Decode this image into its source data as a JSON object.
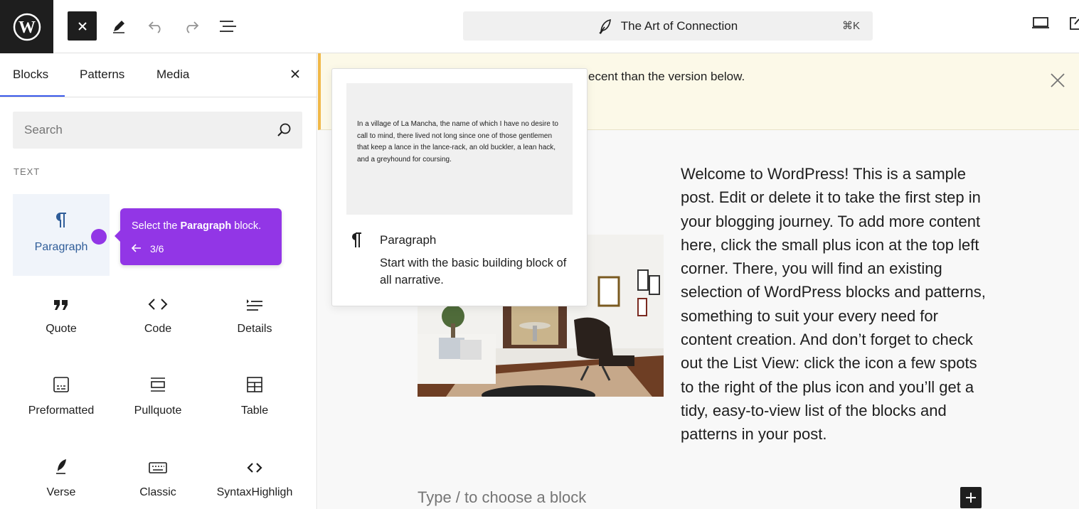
{
  "topbar": {
    "logo_icon": "wordpress-logo",
    "post_title": "The Art of Connection",
    "shortcut": "⌘K",
    "icons": [
      "close-icon",
      "pen-icon",
      "undo-icon",
      "redo-icon",
      "list-view-icon",
      "desktop-view-icon",
      "external-link-icon"
    ]
  },
  "sidebar": {
    "tabs": [
      {
        "label": "Blocks",
        "active": true
      },
      {
        "label": "Patterns",
        "active": false
      },
      {
        "label": "Media",
        "active": false
      }
    ],
    "search_placeholder": "Search",
    "category": "TEXT",
    "blocks": [
      {
        "label": "Paragraph",
        "icon": "paragraph-icon",
        "selected": true
      },
      {
        "label": "Quote",
        "icon": "quote-icon"
      },
      {
        "label": "Code",
        "icon": "code-icon"
      },
      {
        "label": "Details",
        "icon": "details-icon"
      },
      {
        "label": "Preformatted",
        "icon": "preformatted-icon"
      },
      {
        "label": "Pullquote",
        "icon": "pullquote-icon"
      },
      {
        "label": "Table",
        "icon": "table-icon"
      },
      {
        "label": "Verse",
        "icon": "verse-icon"
      },
      {
        "label": "Classic",
        "icon": "keyboard-icon"
      },
      {
        "label": "SyntaxHighligh",
        "icon": "code-brackets-icon"
      }
    ]
  },
  "tour": {
    "text_before": "Select the ",
    "text_bold": "Paragraph",
    "text_after": " block.",
    "step": "3/6",
    "color": "#9236e6"
  },
  "notice": {
    "text": "ecent than the version below."
  },
  "preview": {
    "sample_text": "In a village of La Mancha, the name of which I have no desire to call to mind, there lived not long since one of those gentlemen that keep a lance in the lance-rack, an old buckler, a lean hack, and a greyhound for coursing.",
    "title": "Paragraph",
    "description": "Start with the basic building block of all narrative."
  },
  "post": {
    "body": "Welcome to WordPress! This is a sample post. Edit or delete it to take the first step in your blogging journey. To add more content here, click the small plus icon at the top left corner. There, you will find an existing selection of WordPress blocks and patterns, something to suit your every need for content creation. And don’t forget to check out the List View: click the icon a few spots to the right of the plus icon and you’ll get a tidy, easy-to-view list of the blocks and patterns in your post.",
    "appender_placeholder": "Type / to choose a block"
  },
  "colors": {
    "accent": "#3858e9",
    "dark": "#1e1e1e",
    "notice_bg": "#fcf9e8",
    "notice_border": "#f0b849"
  }
}
